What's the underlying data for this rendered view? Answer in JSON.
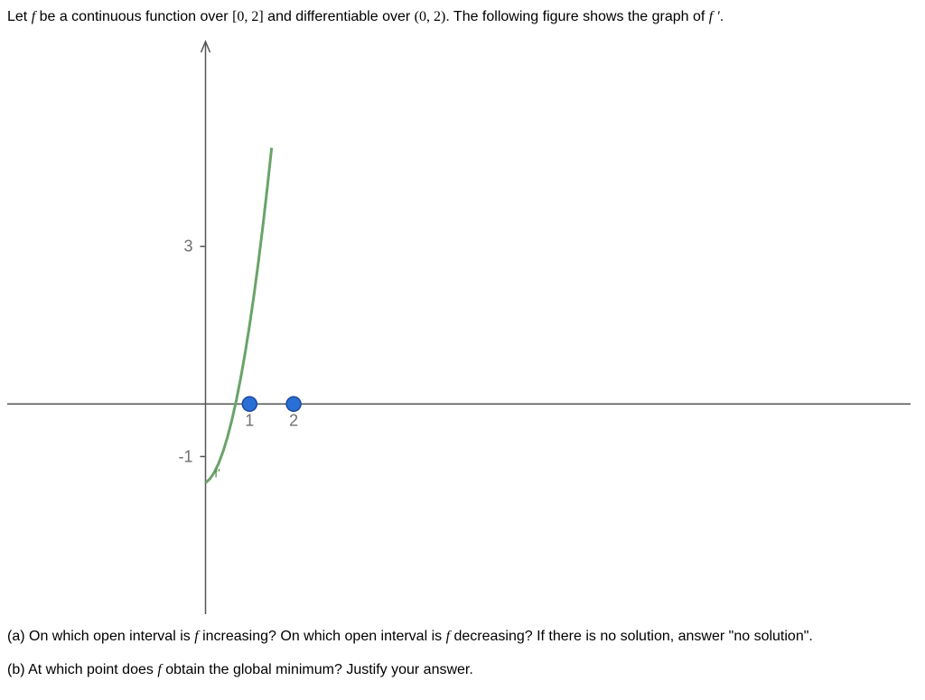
{
  "intro": {
    "let": "Let ",
    "f": "f",
    "cont1": " be a continuous function over ",
    "interval_closed": "[0, 2]",
    "cont2": " and differentiable over ",
    "interval_open": "(0, 2)",
    "cont3": ". The following figure shows the graph of ",
    "fprime": "f ′",
    "period": "."
  },
  "chart_data": {
    "type": "line",
    "title": "",
    "xlabel": "",
    "ylabel": "",
    "xlim": [
      -4.5,
      16
    ],
    "ylim": [
      -4,
      7
    ],
    "y_ticks": [
      -1,
      3
    ],
    "x_ticks": [
      1,
      2
    ],
    "series": [
      {
        "name": "f'",
        "x": [
          0.0,
          0.1,
          0.2,
          0.3,
          0.4,
          0.5,
          0.6,
          0.7,
          0.8,
          0.9,
          1.0,
          1.1,
          1.2,
          1.3,
          1.4,
          1.5
        ],
        "values": [
          -1.5,
          -1.425,
          -1.3,
          -1.125,
          -0.9,
          -0.625,
          -0.3,
          0.075,
          0.5,
          0.975,
          1.5,
          2.075,
          2.7,
          3.375,
          4.1,
          4.875
        ]
      }
    ],
    "points": [
      {
        "x": 1,
        "y": 0
      },
      {
        "x": 2,
        "y": 0
      }
    ],
    "annotations": [
      {
        "x": 0.2,
        "y": -1.4,
        "text": "f'"
      }
    ]
  },
  "questions": {
    "a": {
      "prefix": "(a) On which open interval is ",
      "f": "f",
      "mid1": " increasing? On which open interval is ",
      "mid2": " decreasing? If there is no solution, answer \"no solution\"."
    },
    "b": {
      "prefix": "(b) At which point does ",
      "f": "f",
      "suffix": " obtain the global minimum? Justify your answer."
    }
  }
}
